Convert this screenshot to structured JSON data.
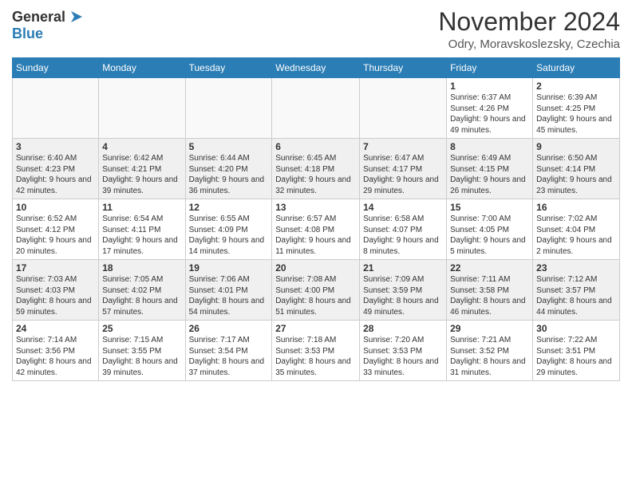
{
  "logo": {
    "general": "General",
    "blue": "Blue"
  },
  "title": {
    "month": "November 2024",
    "location": "Odry, Moravskoslezsky, Czechia"
  },
  "days_of_week": [
    "Sunday",
    "Monday",
    "Tuesday",
    "Wednesday",
    "Thursday",
    "Friday",
    "Saturday"
  ],
  "weeks": [
    [
      {
        "day": "",
        "info": ""
      },
      {
        "day": "",
        "info": ""
      },
      {
        "day": "",
        "info": ""
      },
      {
        "day": "",
        "info": ""
      },
      {
        "day": "",
        "info": ""
      },
      {
        "day": "1",
        "info": "Sunrise: 6:37 AM\nSunset: 4:26 PM\nDaylight: 9 hours and 49 minutes."
      },
      {
        "day": "2",
        "info": "Sunrise: 6:39 AM\nSunset: 4:25 PM\nDaylight: 9 hours and 45 minutes."
      }
    ],
    [
      {
        "day": "3",
        "info": "Sunrise: 6:40 AM\nSunset: 4:23 PM\nDaylight: 9 hours and 42 minutes."
      },
      {
        "day": "4",
        "info": "Sunrise: 6:42 AM\nSunset: 4:21 PM\nDaylight: 9 hours and 39 minutes."
      },
      {
        "day": "5",
        "info": "Sunrise: 6:44 AM\nSunset: 4:20 PM\nDaylight: 9 hours and 36 minutes."
      },
      {
        "day": "6",
        "info": "Sunrise: 6:45 AM\nSunset: 4:18 PM\nDaylight: 9 hours and 32 minutes."
      },
      {
        "day": "7",
        "info": "Sunrise: 6:47 AM\nSunset: 4:17 PM\nDaylight: 9 hours and 29 minutes."
      },
      {
        "day": "8",
        "info": "Sunrise: 6:49 AM\nSunset: 4:15 PM\nDaylight: 9 hours and 26 minutes."
      },
      {
        "day": "9",
        "info": "Sunrise: 6:50 AM\nSunset: 4:14 PM\nDaylight: 9 hours and 23 minutes."
      }
    ],
    [
      {
        "day": "10",
        "info": "Sunrise: 6:52 AM\nSunset: 4:12 PM\nDaylight: 9 hours and 20 minutes."
      },
      {
        "day": "11",
        "info": "Sunrise: 6:54 AM\nSunset: 4:11 PM\nDaylight: 9 hours and 17 minutes."
      },
      {
        "day": "12",
        "info": "Sunrise: 6:55 AM\nSunset: 4:09 PM\nDaylight: 9 hours and 14 minutes."
      },
      {
        "day": "13",
        "info": "Sunrise: 6:57 AM\nSunset: 4:08 PM\nDaylight: 9 hours and 11 minutes."
      },
      {
        "day": "14",
        "info": "Sunrise: 6:58 AM\nSunset: 4:07 PM\nDaylight: 9 hours and 8 minutes."
      },
      {
        "day": "15",
        "info": "Sunrise: 7:00 AM\nSunset: 4:05 PM\nDaylight: 9 hours and 5 minutes."
      },
      {
        "day": "16",
        "info": "Sunrise: 7:02 AM\nSunset: 4:04 PM\nDaylight: 9 hours and 2 minutes."
      }
    ],
    [
      {
        "day": "17",
        "info": "Sunrise: 7:03 AM\nSunset: 4:03 PM\nDaylight: 8 hours and 59 minutes."
      },
      {
        "day": "18",
        "info": "Sunrise: 7:05 AM\nSunset: 4:02 PM\nDaylight: 8 hours and 57 minutes."
      },
      {
        "day": "19",
        "info": "Sunrise: 7:06 AM\nSunset: 4:01 PM\nDaylight: 8 hours and 54 minutes."
      },
      {
        "day": "20",
        "info": "Sunrise: 7:08 AM\nSunset: 4:00 PM\nDaylight: 8 hours and 51 minutes."
      },
      {
        "day": "21",
        "info": "Sunrise: 7:09 AM\nSunset: 3:59 PM\nDaylight: 8 hours and 49 minutes."
      },
      {
        "day": "22",
        "info": "Sunrise: 7:11 AM\nSunset: 3:58 PM\nDaylight: 8 hours and 46 minutes."
      },
      {
        "day": "23",
        "info": "Sunrise: 7:12 AM\nSunset: 3:57 PM\nDaylight: 8 hours and 44 minutes."
      }
    ],
    [
      {
        "day": "24",
        "info": "Sunrise: 7:14 AM\nSunset: 3:56 PM\nDaylight: 8 hours and 42 minutes."
      },
      {
        "day": "25",
        "info": "Sunrise: 7:15 AM\nSunset: 3:55 PM\nDaylight: 8 hours and 39 minutes."
      },
      {
        "day": "26",
        "info": "Sunrise: 7:17 AM\nSunset: 3:54 PM\nDaylight: 8 hours and 37 minutes."
      },
      {
        "day": "27",
        "info": "Sunrise: 7:18 AM\nSunset: 3:53 PM\nDaylight: 8 hours and 35 minutes."
      },
      {
        "day": "28",
        "info": "Sunrise: 7:20 AM\nSunset: 3:53 PM\nDaylight: 8 hours and 33 minutes."
      },
      {
        "day": "29",
        "info": "Sunrise: 7:21 AM\nSunset: 3:52 PM\nDaylight: 8 hours and 31 minutes."
      },
      {
        "day": "30",
        "info": "Sunrise: 7:22 AM\nSunset: 3:51 PM\nDaylight: 8 hours and 29 minutes."
      }
    ]
  ]
}
